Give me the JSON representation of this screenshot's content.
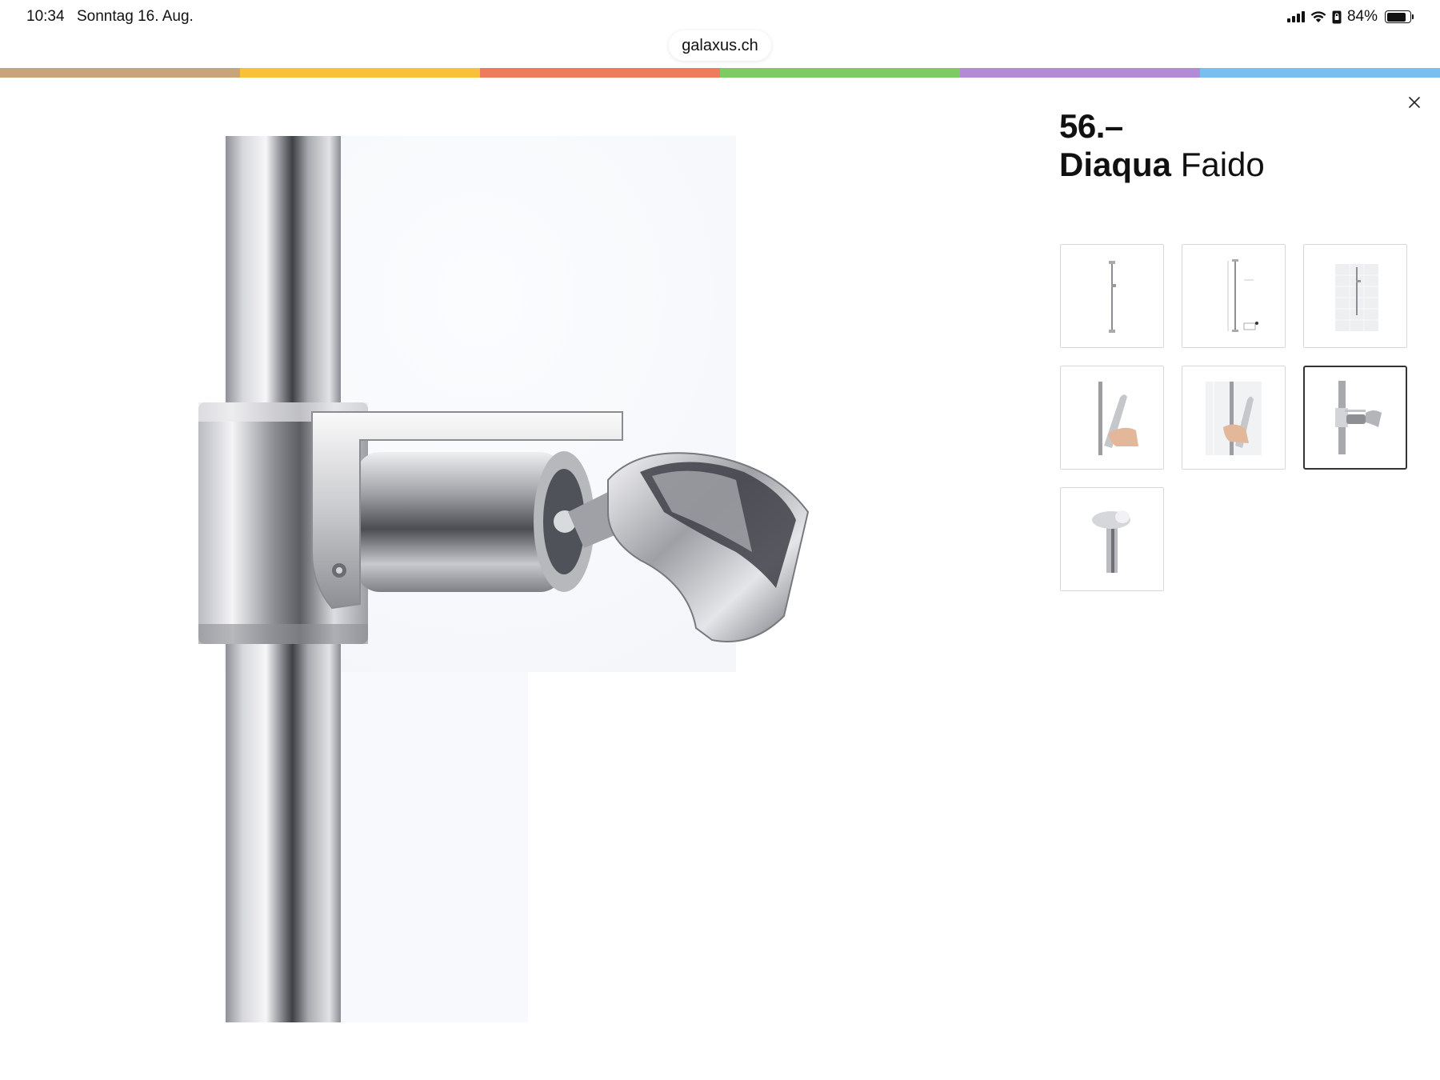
{
  "status_bar": {
    "time": "10:34",
    "date": "Sonntag 16. Aug.",
    "battery": "84%",
    "battery_level": 0.84,
    "icons": [
      "signal-icon",
      "wifi-icon",
      "lock-rotation-icon",
      "battery-icon"
    ]
  },
  "browser": {
    "url": "galaxus.ch"
  },
  "brand_strip_colors": [
    "#c9a47a",
    "#f7c23a",
    "#ef7b5e",
    "#7fcb63",
    "#b38ad6",
    "#78bff0"
  ],
  "product": {
    "price": "56.–",
    "brand": "Diaqua",
    "model": "Faido"
  },
  "gallery": {
    "selected_index": 5,
    "thumbnails": [
      {
        "name": "thumb-rail-front"
      },
      {
        "name": "thumb-rail-dimensions"
      },
      {
        "name": "thumb-rail-tiles"
      },
      {
        "name": "thumb-rail-hand"
      },
      {
        "name": "thumb-rail-hand-tiles"
      },
      {
        "name": "thumb-holder-closeup"
      },
      {
        "name": "thumb-wall-mount"
      }
    ]
  },
  "icons": {
    "close": "close-icon"
  }
}
